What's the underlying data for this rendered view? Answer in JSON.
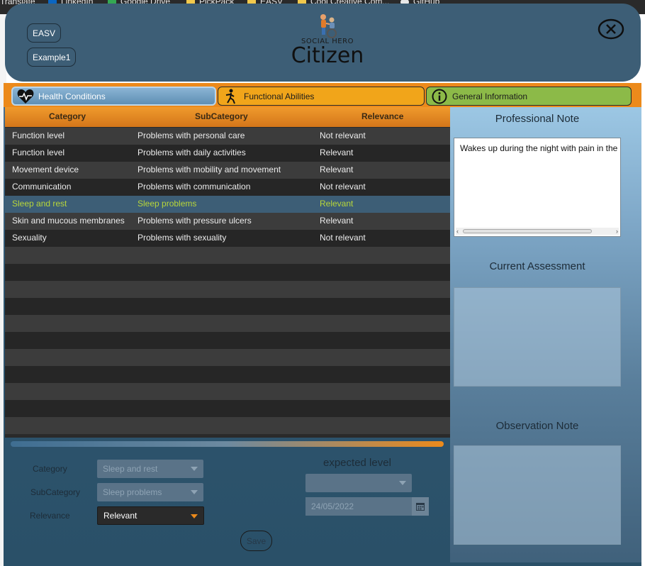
{
  "browser": {
    "bookmarks": [
      "Translate",
      "LinkedIn",
      "Google Drive",
      "PickPack",
      "EASV",
      "Cool Creative Com...",
      "GitHub"
    ]
  },
  "header": {
    "chips": [
      "EASV",
      "Example1"
    ],
    "logo_small": "SOCIAL HERO",
    "logo_main": "Citizen"
  },
  "tabs": [
    {
      "label": "Health Conditions",
      "icon": "heart-pulse-icon"
    },
    {
      "label": "Functional Abilities",
      "icon": "walking-person-icon"
    },
    {
      "label": "General Information",
      "icon": "info-icon"
    }
  ],
  "table": {
    "columns": [
      "Category",
      "SubCategory",
      "Relevance"
    ],
    "rows": [
      {
        "category": "Function level",
        "subcategory": "Problems with personal care",
        "relevance": "Not relevant"
      },
      {
        "category": "Function level",
        "subcategory": "Problems with daily activities",
        "relevance": "Relevant"
      },
      {
        "category": "Movement device",
        "subcategory": "Problems with mobility and movement",
        "relevance": "Relevant"
      },
      {
        "category": "Communication",
        "subcategory": "Problems with communication",
        "relevance": "Not relevant"
      },
      {
        "category": "Sleep and rest",
        "subcategory": "Sleep problems",
        "relevance": "Relevant"
      },
      {
        "category": "Skin and mucous membranes",
        "subcategory": "Problems with pressure ulcers",
        "relevance": "Relevant"
      },
      {
        "category": "Sexuality",
        "subcategory": "Problems with sexuality",
        "relevance": "Not relevant"
      }
    ],
    "selected_row": 4
  },
  "form": {
    "category_label": "Category",
    "category_value": "Sleep and rest",
    "subcategory_label": "SubCategory",
    "subcategory_value": "Sleep problems",
    "relevance_label": "Relevance",
    "relevance_value": "Relevant",
    "expected_level_label": "expected level",
    "expected_level_value": "",
    "date_value": "24/05/2022",
    "save_label": "Save"
  },
  "panel": {
    "professional_note_title": "Professional Note",
    "professional_note_text": "Wakes up during the night with pain in the",
    "current_assessment_title": "Current Assessment",
    "observation_note_title": "Observation Note"
  },
  "colors": {
    "accent_orange": "#ec8a1b",
    "header_blue": "#3d5e76",
    "selected_text": "#b8d63a"
  }
}
